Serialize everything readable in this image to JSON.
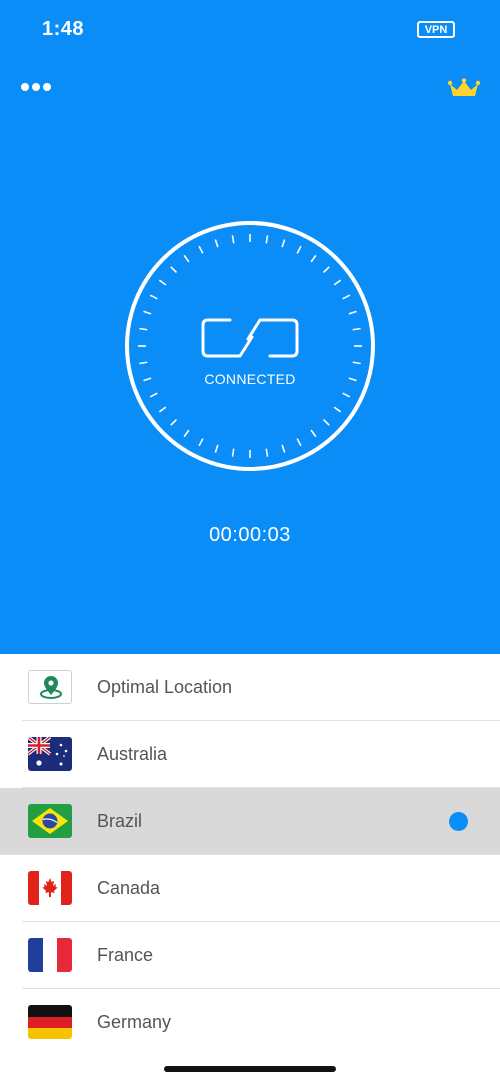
{
  "status_bar": {
    "time": "1:48",
    "vpn_badge": "VPN"
  },
  "header": {
    "menu_icon": "more-horizontal-icon",
    "premium_icon": "crown-icon",
    "crown_color": "#ffd42a"
  },
  "connection": {
    "status": "CONNECTED",
    "timer": "00:00:03",
    "icon": "link-icon"
  },
  "colors": {
    "accent": "#0a8df7",
    "selected_row": "#d9d9d9"
  },
  "locations": [
    {
      "label": "Optimal Location",
      "icon": "location-pin-icon",
      "selected": false
    },
    {
      "label": "Australia",
      "icon": "flag-australia-icon",
      "selected": false
    },
    {
      "label": "Brazil",
      "icon": "flag-brazil-icon",
      "selected": true
    },
    {
      "label": "Canada",
      "icon": "flag-canada-icon",
      "selected": false
    },
    {
      "label": "France",
      "icon": "flag-france-icon",
      "selected": false
    },
    {
      "label": "Germany",
      "icon": "flag-germany-icon",
      "selected": false
    }
  ]
}
